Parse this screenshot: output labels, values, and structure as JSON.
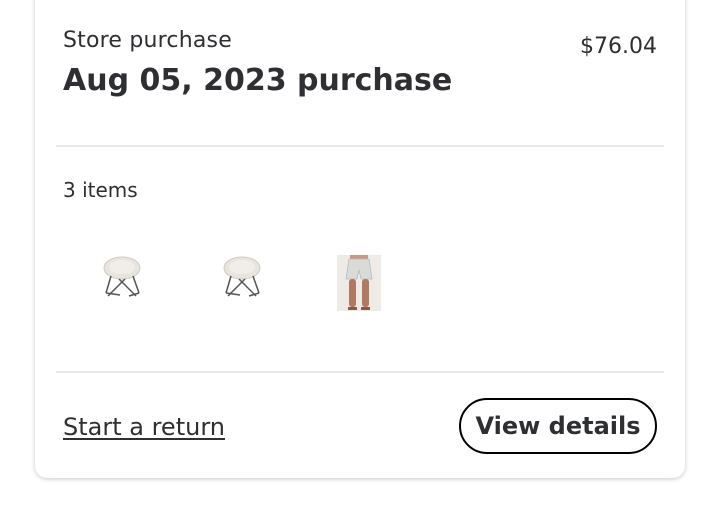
{
  "order": {
    "type_label": "Store purchase",
    "total": "$76.04",
    "title": "Aug 05, 2023 purchase",
    "items_count": "3 items",
    "items": [
      {
        "kind": "saucer-chair-icon"
      },
      {
        "kind": "saucer-chair-icon"
      },
      {
        "kind": "shorts-product-icon"
      }
    ]
  },
  "actions": {
    "start_return": "Start a return",
    "view_details": "View details"
  }
}
